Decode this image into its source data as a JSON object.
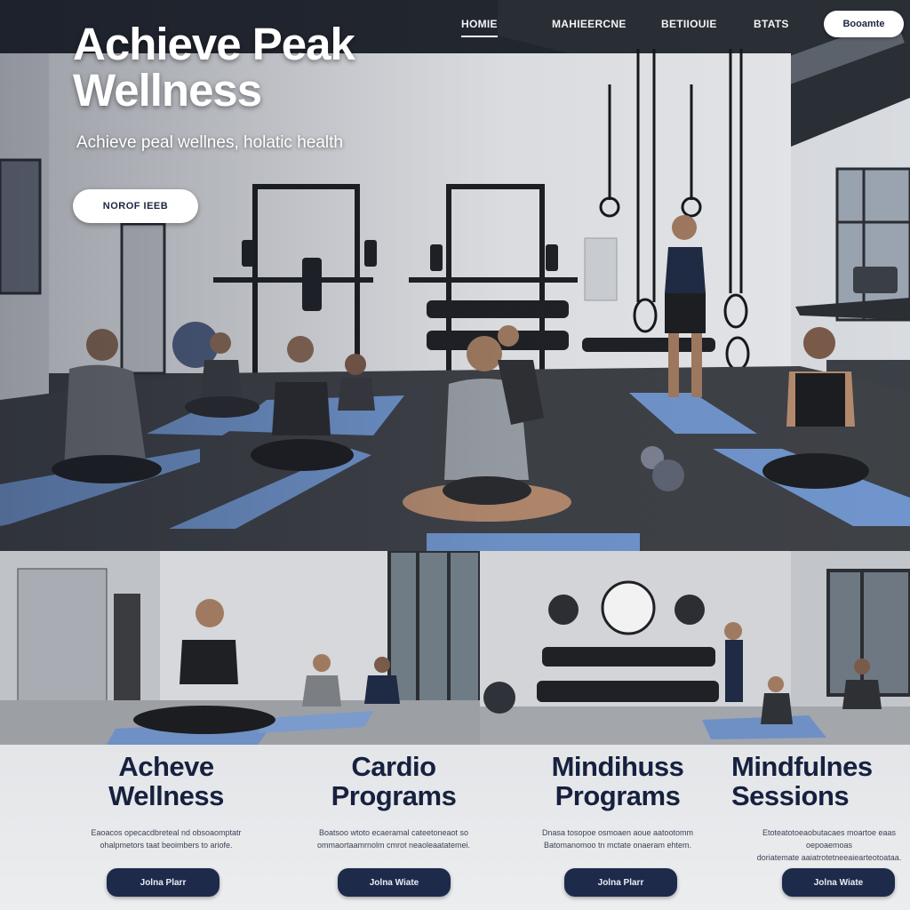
{
  "nav": {
    "links": [
      {
        "label": "HOMIE",
        "active": true
      },
      {
        "label": "MAHIEERCNE",
        "active": false
      },
      {
        "label": "BETIIOUIE",
        "active": false
      },
      {
        "label": "BTATS",
        "active": false
      }
    ],
    "cta_label": "Booamte"
  },
  "hero": {
    "title": "Achieve Peak Wellness",
    "subtitle": "Achieve peal wellnes, holatic health",
    "cta_label": "NOROF IEEB"
  },
  "cards": [
    {
      "title": "Acheve\nWellness",
      "description": "Eaoacos opecacdbreteal nd obsoaomptatr\nohalpmetors taat beoimbers to ariofe.",
      "button_label": "Jolna Plarr"
    },
    {
      "title": "Cardio\nPrograms",
      "description": "Boatsoo wtoto ecaeramal cateetoneaot so\nommaortaamrnolm cmrot neaoleaatatemei.",
      "button_label": "Jolna Wiate"
    },
    {
      "title": "Mindihuss\nPrograms",
      "description": "Dnasa tosopoe osmoaen aoue aatootomm\nBatomanomoo tn mctate onaeram ehtem.",
      "button_label": "Jolna Plarr"
    },
    {
      "title": "Mindfulnes\nSessions",
      "description": "Etoteatotoeaobutacaes moartoe eaas oepoaemoas\ndoriatemate aaiatrotetneeaiearteotoataa.",
      "button_label": "Jolna Wiate"
    }
  ],
  "colors": {
    "accent_navy": "#1e2a4a",
    "heading_navy": "#16213f",
    "mat_blue": "#6f8fc4"
  }
}
